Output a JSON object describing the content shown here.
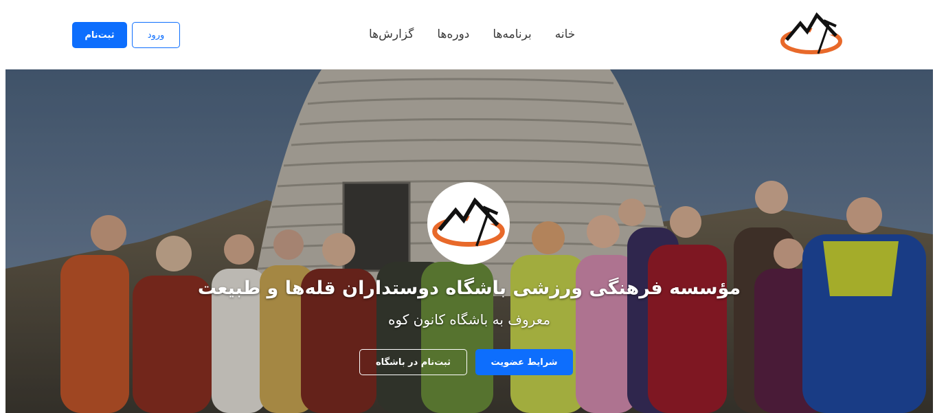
{
  "header": {
    "logo_icon": "mountain-logo-icon",
    "nav": [
      {
        "label": "خانه"
      },
      {
        "label": "برنامه‌ها"
      },
      {
        "label": "دوره‌ها"
      },
      {
        "label": "گزارش‌ها"
      }
    ],
    "login_label": "ورود",
    "signup_label": "ثبت‌نام"
  },
  "hero": {
    "badge_icon": "mountain-logo-icon",
    "title": "مؤسسه فرهنگی ورزشی باشگاه دوستداران قله‌ها و طبیعت",
    "subtitle": "معروف به باشگاه کانون کوه",
    "primary_button": "شرایط عضویت",
    "secondary_button": "ثبت‌نام در باشگاه"
  },
  "colors": {
    "accent": "#0d6efd",
    "logo_orange": "#e8692a",
    "logo_black": "#111111"
  }
}
